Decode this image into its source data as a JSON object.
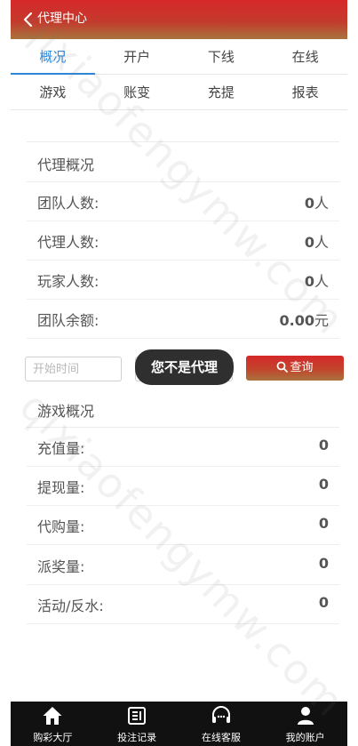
{
  "header": {
    "title": "代理中心"
  },
  "tabs": {
    "row1": [
      "概况",
      "开户",
      "下线",
      "在线"
    ],
    "row2": [
      "游戏",
      "账变",
      "充提",
      "报表"
    ],
    "active": "概况"
  },
  "agent_overview": {
    "title": "代理概况",
    "rows": [
      {
        "label": "团队人数:",
        "value": "0",
        "unit": "人"
      },
      {
        "label": "代理人数:",
        "value": "0",
        "unit": "人"
      },
      {
        "label": "玩家人数:",
        "value": "0",
        "unit": "人"
      },
      {
        "label": "团队余额:",
        "value": "0.00",
        "unit": "元"
      }
    ]
  },
  "query": {
    "start_placeholder": "开始时间",
    "button_label": "查询",
    "toast": "您不是代理"
  },
  "game_overview": {
    "title": "游戏概况",
    "rows": [
      {
        "label": "充值量:",
        "value": "0"
      },
      {
        "label": "提现量:",
        "value": "0"
      },
      {
        "label": "代购量:",
        "value": "0"
      },
      {
        "label": "派奖量:",
        "value": "0"
      },
      {
        "label": "活动/反水:",
        "value": "0"
      }
    ]
  },
  "bottom_nav": {
    "items": [
      {
        "label": "购彩大厅",
        "icon": "home-icon"
      },
      {
        "label": "投注记录",
        "icon": "records-icon"
      },
      {
        "label": "在线客服",
        "icon": "headset-icon"
      },
      {
        "label": "我的账户",
        "icon": "user-icon"
      }
    ]
  },
  "watermark": {
    "text": "qixiaofengymw.com"
  },
  "colors": {
    "accent_red": "#d6282a",
    "accent_gold": "#a8743d",
    "tab_active": "#2f86d6",
    "nav_bg": "#111111"
  }
}
